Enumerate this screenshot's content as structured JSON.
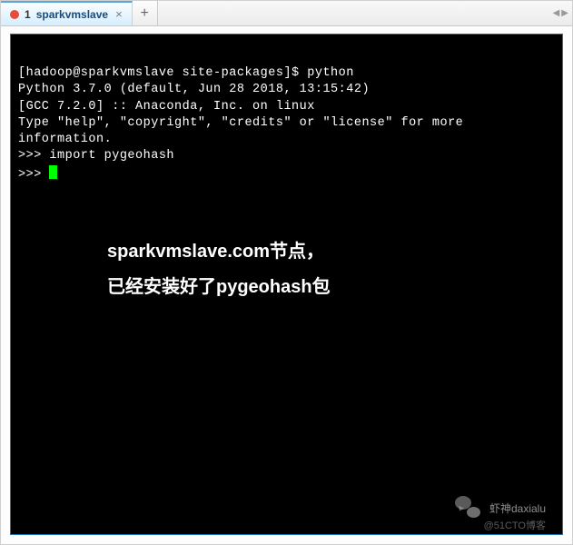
{
  "tabs": {
    "active": {
      "number": "1",
      "label": "sparkvmslave",
      "close_glyph": "×"
    },
    "new_tab_glyph": "+"
  },
  "nav": {
    "left_glyph": "◀",
    "right_glyph": "▶"
  },
  "terminal": {
    "lines": [
      "",
      "[hadoop@sparkvmslave site-packages]$ python",
      "Python 3.7.0 (default, Jun 28 2018, 13:15:42)",
      "[GCC 7.2.0] :: Anaconda, Inc. on linux",
      "Type \"help\", \"copyright\", \"credits\" or \"license\" for more information.",
      ">>> import pygeohash",
      ">>> "
    ]
  },
  "annotation": {
    "line1": "sparkvmslave.com节点，",
    "line2": "已经安装好了pygeohash包"
  },
  "watermark": {
    "primary": "虾神daxialu",
    "secondary": "@51CTO博客"
  }
}
